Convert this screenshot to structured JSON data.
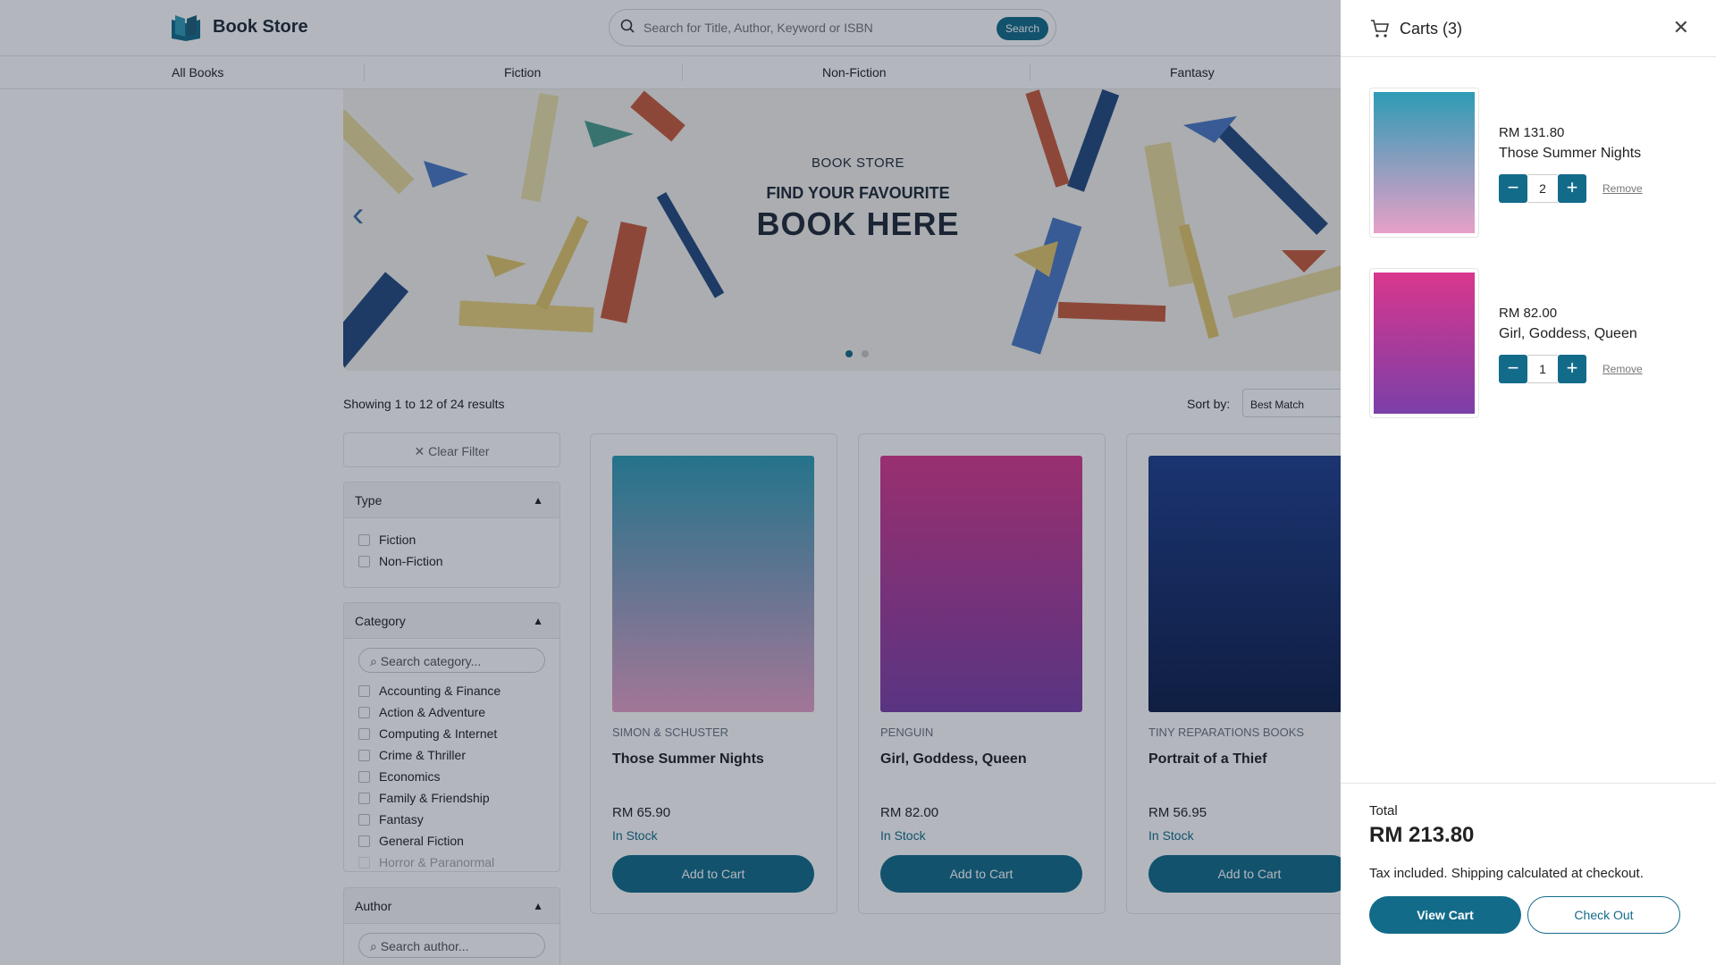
{
  "header": {
    "brand": "Book Store",
    "search_placeholder": "Search for Title, Author, Keyword or ISBN",
    "search_button": "Search"
  },
  "nav": [
    "All Books",
    "Fiction",
    "Non-Fiction",
    "Fantasy"
  ],
  "banner": {
    "small": "BOOK STORE",
    "line1": "FIND YOUR FAVOURITE",
    "line2": "BOOK HERE"
  },
  "results": {
    "summary": "Showing 1 to 12 of 24 results",
    "sort_label": "Sort by:",
    "sort_value": "Best Match"
  },
  "filters": {
    "clear": "Clear Filter",
    "type": {
      "title": "Type",
      "items": [
        "Fiction",
        "Non-Fiction"
      ]
    },
    "category": {
      "title": "Category",
      "search_placeholder": "Search category...",
      "items": [
        "Accounting & Finance",
        "Action & Adventure",
        "Computing & Internet",
        "Crime & Thriller",
        "Economics",
        "Family & Friendship",
        "Fantasy",
        "General Fiction",
        "Horror & Paranormal"
      ]
    },
    "author": {
      "title": "Author",
      "search_placeholder": "Search author..."
    }
  },
  "products": [
    {
      "publisher": "SIMON & SCHUSTER",
      "title": "Those Summer Nights",
      "price": "RM 65.90",
      "stock": "In Stock",
      "button": "Add to Cart",
      "cover": "#2e9bb5"
    },
    {
      "publisher": "PENGUIN",
      "title": "Girl, Goddess, Queen",
      "price": "RM 82.00",
      "stock": "In Stock",
      "button": "Add to Cart",
      "cover": "#d9378d"
    },
    {
      "publisher": "TINY REPARATIONS BOOKS",
      "title": "Portrait of a Thief",
      "price": "RM 56.95",
      "stock": "In Stock",
      "button": "Add to Cart",
      "cover": "#1f3f8f"
    }
  ],
  "cart": {
    "title": "Carts (3)",
    "items": [
      {
        "price": "RM 131.80",
        "title": "Those Summer Nights",
        "qty": "2",
        "remove": "Remove",
        "cover": "#2e9bb5"
      },
      {
        "price": "RM 82.00",
        "title": "Girl, Goddess, Queen",
        "qty": "1",
        "remove": "Remove",
        "cover": "#d9378d"
      }
    ],
    "total_label": "Total",
    "total_value": "RM 213.80",
    "tax_note": "Tax included. Shipping calculated at checkout.",
    "view_cart": "View Cart",
    "checkout": "Check Out"
  }
}
